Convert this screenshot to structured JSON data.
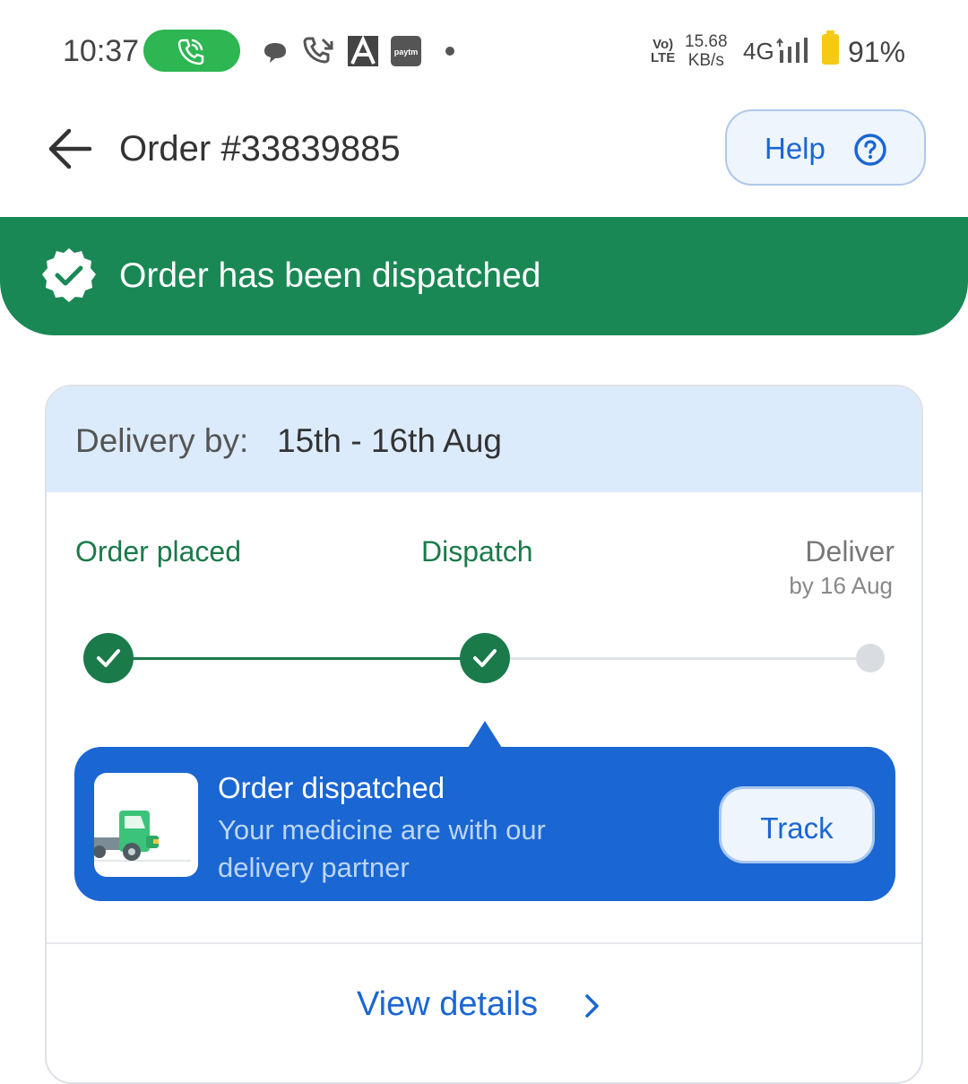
{
  "status_bar": {
    "time": "10:37",
    "volte_line1": "Vo)",
    "volte_line2": "LTE",
    "speed_value": "15.68",
    "speed_unit": "KB/s",
    "network": "4G",
    "battery": "91%",
    "notification_icons": [
      "phone-call-icon",
      "chat-bubble-icon",
      "missed-call-icon",
      "a-app-icon",
      "paytm-icon"
    ]
  },
  "header": {
    "title": "Order #33839885",
    "help_label": "Help"
  },
  "banner": {
    "text": "Order has been dispatched",
    "color": "#1a8855"
  },
  "delivery": {
    "label": "Delivery by:",
    "value": "15th - 16th Aug"
  },
  "steps": [
    {
      "label": "Order placed",
      "status": "done"
    },
    {
      "label": "Dispatch",
      "status": "done"
    },
    {
      "label": "Deliver",
      "sublabel": "by 16 Aug",
      "status": "pending"
    }
  ],
  "status_card": {
    "title": "Order dispatched",
    "subtitle": "Your medicine are with our delivery partner",
    "track_label": "Track",
    "color": "#1a66d3"
  },
  "footer": {
    "view_details_label": "View details"
  },
  "colors": {
    "accent_blue": "#1a66d3",
    "success_green": "#1a7a4a",
    "header_tint": "#dcebfb"
  }
}
